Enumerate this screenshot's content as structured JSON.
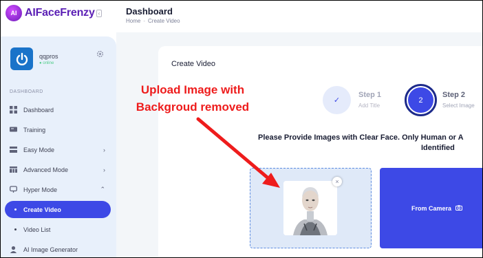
{
  "brand": {
    "name": "AIFaceFrenzy",
    "badge": "AI"
  },
  "header": {
    "title": "Dashboard",
    "breadcrumb": [
      "Home",
      "Create Video"
    ]
  },
  "user": {
    "name": "qqpros",
    "status": "online"
  },
  "sidebar": {
    "section": "DASHBOARD",
    "items": [
      {
        "label": "Dashboard",
        "icon": "grid-icon"
      },
      {
        "label": "Training",
        "icon": "monitor-icon"
      },
      {
        "label": "Easy Mode",
        "icon": "layers-icon",
        "chevron": "right"
      },
      {
        "label": "Advanced Mode",
        "icon": "table-icon",
        "chevron": "right"
      },
      {
        "label": "Hyper Mode",
        "icon": "screen-icon",
        "chevron": "down"
      },
      {
        "label": "Create Video",
        "active": true
      },
      {
        "label": "Video List"
      },
      {
        "label": "AI Image Generator",
        "icon": "user-icon"
      }
    ]
  },
  "main": {
    "title": "Create Video",
    "steps": [
      {
        "number": "✓",
        "label": "Step 1",
        "sub": "Add Title"
      },
      {
        "number": "2",
        "label": "Step 2",
        "sub": "Select Image"
      }
    ],
    "instruction_line1": "Please Provide Images with Clear Face. Only Human or A",
    "instruction_line2": "Identified",
    "close_glyph": "×",
    "camera_label": "From Camera"
  },
  "annotation": {
    "line1": "Upload Image with",
    "line2": "Backgroud removed",
    "color": "#ee1c1c"
  },
  "colors": {
    "accent": "#3d49e6",
    "brand": "#5b1fb5",
    "sidebar_bg": "#e8f0fb",
    "upload_bg": "#dfe9f8"
  }
}
